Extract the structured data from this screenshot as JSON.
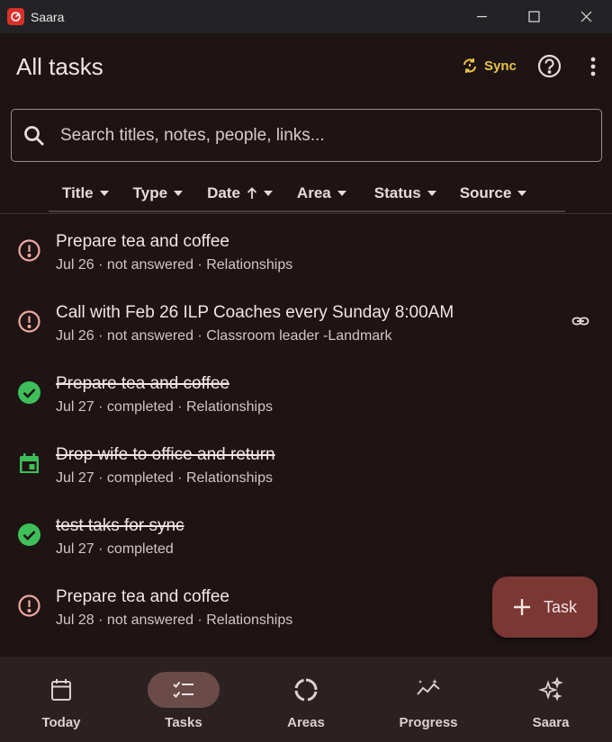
{
  "window": {
    "title": "Saara"
  },
  "header": {
    "title": "All tasks",
    "sync_label": "Sync"
  },
  "search": {
    "placeholder": "Search titles, notes, people, links..."
  },
  "filters": [
    {
      "label": "Title"
    },
    {
      "label": "Type"
    },
    {
      "label": "Date"
    },
    {
      "label": "Area"
    },
    {
      "label": "Status"
    },
    {
      "label": "Source"
    }
  ],
  "tasks": [
    {
      "title": "Prepare tea and coffee",
      "meta": "Jul 26 · not answered · Relationships",
      "status": "not-answered",
      "icon": "alert-circle-icon",
      "has_link": false
    },
    {
      "title": "Call with Feb 26 ILP Coaches every Sunday 8:00AM",
      "meta": "Jul 26 · not answered · Classroom leader -Landmark",
      "status": "not-answered",
      "icon": "alert-circle-icon",
      "has_link": true
    },
    {
      "title": "Prepare tea and coffee",
      "meta": "Jul 27 · completed · Relationships",
      "status": "completed",
      "icon": "check-circle-icon",
      "has_link": false
    },
    {
      "title": "Drop wife to office and return",
      "meta": "Jul 27 · completed · Relationships",
      "status": "completed",
      "icon": "calendar-event-icon",
      "has_link": false
    },
    {
      "title": "test taks for sync",
      "meta": "Jul 27 · completed",
      "status": "completed",
      "icon": "check-circle-icon",
      "has_link": false
    },
    {
      "title": "Prepare tea and coffee",
      "meta": "Jul 28 · not answered · Relationships",
      "status": "not-answered",
      "icon": "alert-circle-icon",
      "has_link": false
    }
  ],
  "fab": {
    "label": "Task"
  },
  "nav": [
    {
      "label": "Today",
      "icon": "calendar-icon",
      "active": false
    },
    {
      "label": "Tasks",
      "icon": "checklist-icon",
      "active": true
    },
    {
      "label": "Areas",
      "icon": "ring-icon",
      "active": false
    },
    {
      "label": "Progress",
      "icon": "sparkline-icon",
      "active": false
    },
    {
      "label": "Saara",
      "icon": "sparkles-icon",
      "active": false
    }
  ],
  "colors": {
    "background": "#1e1414",
    "accent_sync": "#e8c34a",
    "alert": "#f0a8a0",
    "success": "#3fbf5a",
    "fab": "#7a3734",
    "nav_active": "#6a4b47"
  }
}
